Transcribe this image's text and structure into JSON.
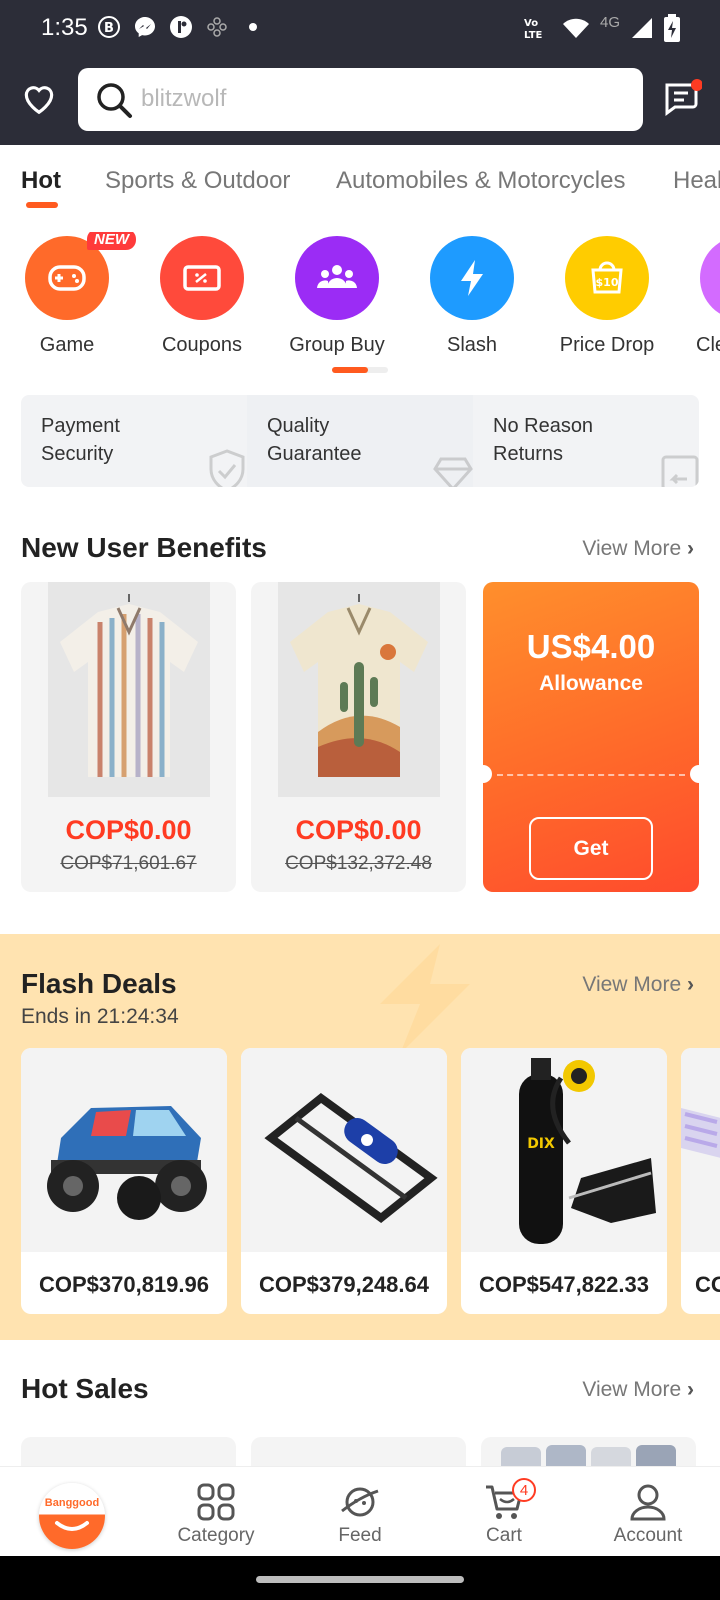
{
  "status_bar": {
    "time": "1:35",
    "network": "4G"
  },
  "search": {
    "placeholder": "blitzwolf"
  },
  "tabs": [
    "Hot",
    "Sports & Outdoor",
    "Automobiles & Motorcycles",
    "Heal"
  ],
  "categories": [
    {
      "label": "Game",
      "color": "#ff6a2a",
      "badge": "NEW"
    },
    {
      "label": "Coupons",
      "color": "#ff4a3b"
    },
    {
      "label": "Group Buy",
      "color": "#9b2cf5"
    },
    {
      "label": "Slash",
      "color": "#1e9bff"
    },
    {
      "label": "Price Drop",
      "color": "#ffcc00"
    },
    {
      "label": "Cle",
      "color": "#d36bff"
    }
  ],
  "guarantees": [
    {
      "line1": "Payment",
      "line2": "Security"
    },
    {
      "line1": "Quality",
      "line2": "Guarantee"
    },
    {
      "line1": "No Reason",
      "line2": "Returns"
    }
  ],
  "new_user": {
    "title": "New User Benefits",
    "view_more": "View More",
    "products": [
      {
        "price": "COP$0.00",
        "old_price": "COP$71,601.67"
      },
      {
        "price": "COP$0.00",
        "old_price": "COP$132,372.48"
      }
    ],
    "allowance": {
      "amount": "US$4.00",
      "label": "Allowance",
      "button": "Get"
    }
  },
  "flash_deals": {
    "title": "Flash Deals",
    "ends": "Ends in 21:24:34",
    "view_more": "View More",
    "items": [
      {
        "price": "COP$370,819.96"
      },
      {
        "price": "COP$379,248.64"
      },
      {
        "price": "COP$547,822.33"
      },
      {
        "price": "CO"
      }
    ]
  },
  "hot_sales": {
    "title": "Hot Sales",
    "view_more": "View More"
  },
  "bottom_nav": {
    "home_logo": "Banggood",
    "category": "Category",
    "feed": "Feed",
    "cart": "Cart",
    "cart_count": "4",
    "account": "Account"
  },
  "colors": {
    "accent": "#ff5a1f",
    "header": "#2c2d38",
    "flash_bg": "#ffe3b0"
  }
}
